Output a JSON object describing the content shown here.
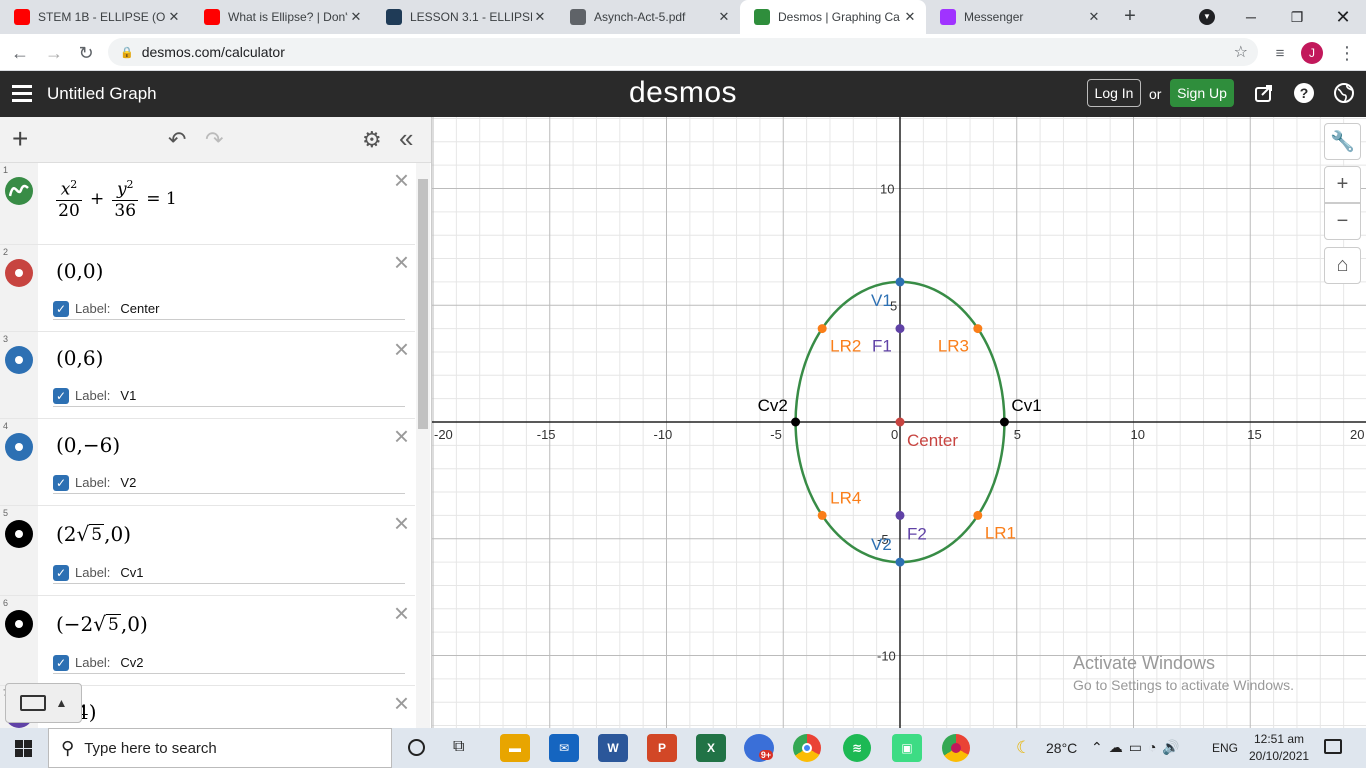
{
  "browser": {
    "tabs": [
      {
        "title": "STEM 1B - ELLIPSE (OF",
        "favicon": "youtube-icon",
        "color": "#ff0000"
      },
      {
        "title": "What is Ellipse? | Don't",
        "favicon": "youtube-icon",
        "color": "#ff0000"
      },
      {
        "title": "LESSON 3.1 - ELLIPSE",
        "favicon": "s-icon",
        "color": "#1f3b57"
      },
      {
        "title": "Asynch-Act-5.pdf",
        "favicon": "globe-icon",
        "color": "#5f6368"
      },
      {
        "title": "Desmos | Graphing Ca",
        "favicon": "desmos-icon",
        "color": "#2f8e3c",
        "active": true
      },
      {
        "title": "Messenger",
        "favicon": "messenger-icon",
        "color": "#a033ff"
      }
    ],
    "url": "desmos.com/calculator",
    "profile_initial": "J"
  },
  "desmos": {
    "graph_title": "Untitled Graph",
    "logo": "desmos",
    "login": "Log In",
    "or": "or",
    "signup": "Sign Up"
  },
  "expressions": [
    {
      "num": "1",
      "type": "equation",
      "color": "#388c46"
    },
    {
      "num": "2",
      "type": "point",
      "text": "(0,0)",
      "color": "#c74440",
      "label_prefix": "Label:",
      "label": "Center"
    },
    {
      "num": "3",
      "type": "point",
      "text": "(0,6)",
      "color": "#2d70b3",
      "label_prefix": "Label:",
      "label": "V1"
    },
    {
      "num": "4",
      "type": "point",
      "text": "(0,−6)",
      "color": "#2d70b3",
      "label_prefix": "Label:",
      "label": "V2"
    },
    {
      "num": "5",
      "type": "point-sqrt",
      "pre": "(2",
      "rad": "5",
      "post": ",0)",
      "color": "#000000",
      "label_prefix": "Label:",
      "label": "Cv1"
    },
    {
      "num": "6",
      "type": "point-sqrt",
      "pre": "(−2",
      "rad": "5",
      "post": ",0)",
      "color": "#000000",
      "label_prefix": "Label:",
      "label": "Cv2"
    },
    {
      "num": "7",
      "type": "partial",
      "text": "4)",
      "color": "#6042a6"
    }
  ],
  "equation": {
    "x_num": "x",
    "x_den": "20",
    "y_num": "y",
    "y_den": "36",
    "plus": "+",
    "rhs": "= 1",
    "exp": "2"
  },
  "graph": {
    "x_ticks": [
      "-20",
      "-15",
      "-10",
      "-5",
      "0",
      "5",
      "10",
      "15",
      "20"
    ],
    "y_ticks": [
      "10",
      "5",
      "-5",
      "-10"
    ],
    "ellipse": {
      "a2": 20,
      "b2": 36,
      "color": "#388c46"
    },
    "points": [
      {
        "x": 0,
        "y": 0,
        "label": "Center",
        "color": "#c74440"
      },
      {
        "x": 0,
        "y": 6,
        "label": "V1",
        "color": "#2d70b3"
      },
      {
        "x": 0,
        "y": -6,
        "label": "V2",
        "color": "#2d70b3"
      },
      {
        "x": 4.4721,
        "y": 0,
        "label": "Cv1",
        "color": "#000000"
      },
      {
        "x": -4.4721,
        "y": 0,
        "label": "Cv2",
        "color": "#000000"
      },
      {
        "x": 0,
        "y": 4,
        "label": "F1",
        "color": "#6042a6"
      },
      {
        "x": 0,
        "y": -4,
        "label": "F2",
        "color": "#6042a6"
      },
      {
        "x": 3.333,
        "y": 4,
        "label": "LR3",
        "color": "#fa7e19"
      },
      {
        "x": -3.333,
        "y": 4,
        "label": "LR2",
        "color": "#fa7e19"
      },
      {
        "x": 3.333,
        "y": -4,
        "label": "LR1",
        "color": "#fa7e19"
      },
      {
        "x": -3.333,
        "y": -4,
        "label": "LR4",
        "color": "#fa7e19"
      }
    ]
  },
  "watermark": {
    "line1": "Activate Windows",
    "line2": "Go to Settings to activate Windows."
  },
  "taskbar": {
    "search_placeholder": "Type here to search",
    "weather": "28°C",
    "lang": "ENG",
    "time": "12:51 am",
    "date": "20/10/2021",
    "notif_badge": "9+"
  }
}
